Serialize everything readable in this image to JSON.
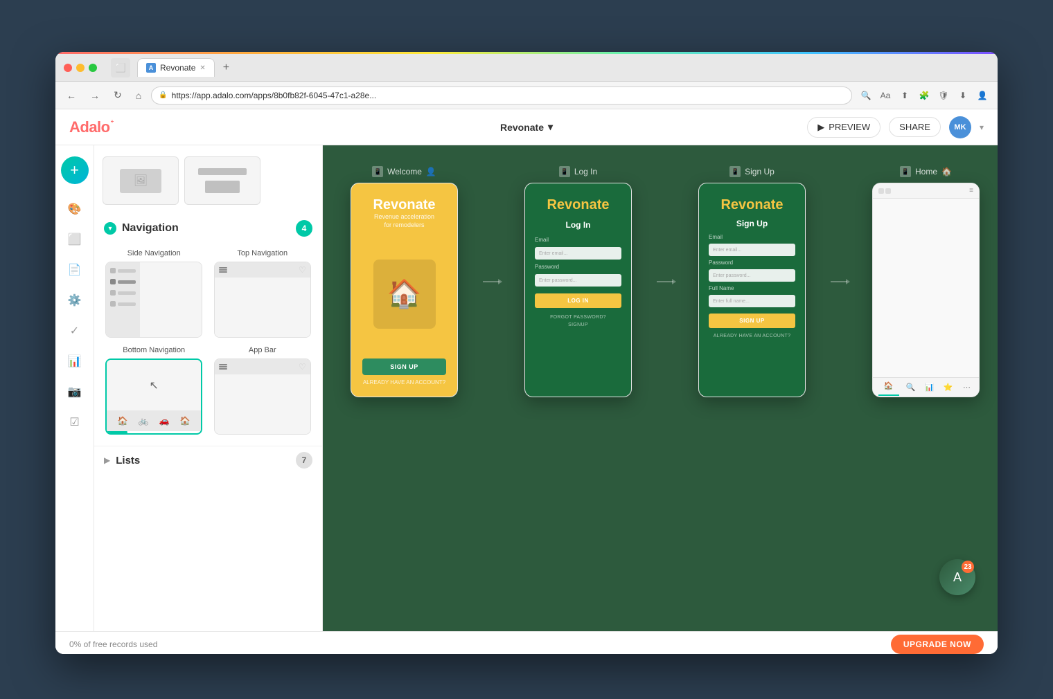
{
  "browser": {
    "tab_title": "Revonate",
    "url": "https://app.adalo.com/apps/8b0fb82f-6045-47c1-a28e...",
    "tab_favicon": "A"
  },
  "header": {
    "logo": "Adalo",
    "logo_mark": "+",
    "app_name": "Revonate",
    "preview_label": "PREVIEW",
    "share_label": "SHARE",
    "user_initials": "MK",
    "chevron": "▾"
  },
  "sidebar": {
    "add_label": "+",
    "icons": [
      "🎨",
      "⬜",
      "📄",
      "⚙️",
      "✓",
      "📊",
      "📷",
      "✔"
    ]
  },
  "components_panel": {
    "section_navigation": {
      "title": "Navigation",
      "count": "4",
      "items": [
        {
          "label": "Side Navigation"
        },
        {
          "label": "Top Navigation"
        },
        {
          "label": "Bottom Navigation"
        },
        {
          "label": "App Bar"
        }
      ]
    },
    "section_lists": {
      "title": "Lists",
      "count": "7"
    }
  },
  "screens": [
    {
      "name": "Welcome",
      "icon": "📱",
      "has_home_icon": false,
      "content": {
        "logo": "Revonate",
        "tagline": "Revenue acceleration\nfor remodelers",
        "cta": "SIGN UP",
        "link": "ALREADY HAVE AN ACCOUNT?"
      }
    },
    {
      "name": "Log In",
      "icon": "📱",
      "content": {
        "title": "Revonate",
        "subtitle": "Log In",
        "email_label": "Email",
        "email_placeholder": "Enter email...",
        "password_label": "Password",
        "password_placeholder": "Enter password...",
        "cta": "LOG IN",
        "forgot_label": "FORGOT PASSWORD?",
        "signup_label": "SIGNUP"
      }
    },
    {
      "name": "Sign Up",
      "icon": "📱",
      "content": {
        "title": "Revonate",
        "subtitle": "Sign Up",
        "email_label": "Email",
        "email_placeholder": "Enter email...",
        "password_label": "Password",
        "password_placeholder": "Enter password...",
        "fullname_label": "Full Name",
        "fullname_placeholder": "Enter full name...",
        "cta": "SIGN UP",
        "link": "ALREADY HAVE AN ACCOUNT?"
      }
    },
    {
      "name": "Home",
      "icon": "📱",
      "has_home_icon": true,
      "content": {}
    }
  ],
  "status_bar": {
    "free_records_text": "0% of free records used",
    "upgrade_label": "UPGRADE NOW"
  },
  "notification_badge": {
    "count": "23"
  }
}
